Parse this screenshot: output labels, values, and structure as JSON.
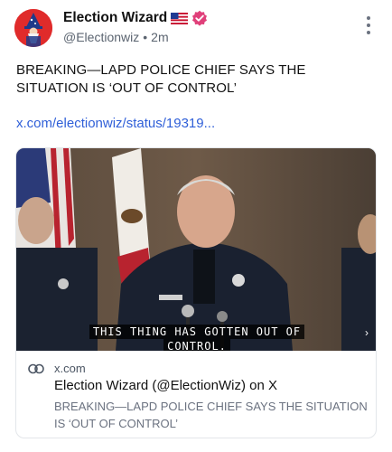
{
  "author": {
    "display_name": "Election Wizard",
    "handle": "@Electionwiz",
    "separator": "•",
    "time_ago": "2m",
    "flag_icon": "us-flag-icon",
    "verified_icon": "verified-badge-icon"
  },
  "post": {
    "text": "BREAKING—LAPD POLICE CHIEF SAYS THE SITUATION IS ‘OUT OF CONTROL’",
    "link_text": "x.com/electionwiz/status/19319..."
  },
  "card": {
    "subtitle_line1": "THIS THING HAS GOTTEN OUT OF",
    "subtitle_line2": "CONTROL.",
    "domain": "x.com",
    "title": "Election Wizard (@ElectionWiz) on X",
    "description": "BREAKING—LAPD POLICE CHIEF SAYS THE SITUATION IS ‘OUT OF CONTROL’"
  },
  "colors": {
    "link": "#2f5fd8",
    "verified": "#e0407a",
    "avatar_bg": "#e02b2b",
    "muted_text": "#5b6470"
  }
}
